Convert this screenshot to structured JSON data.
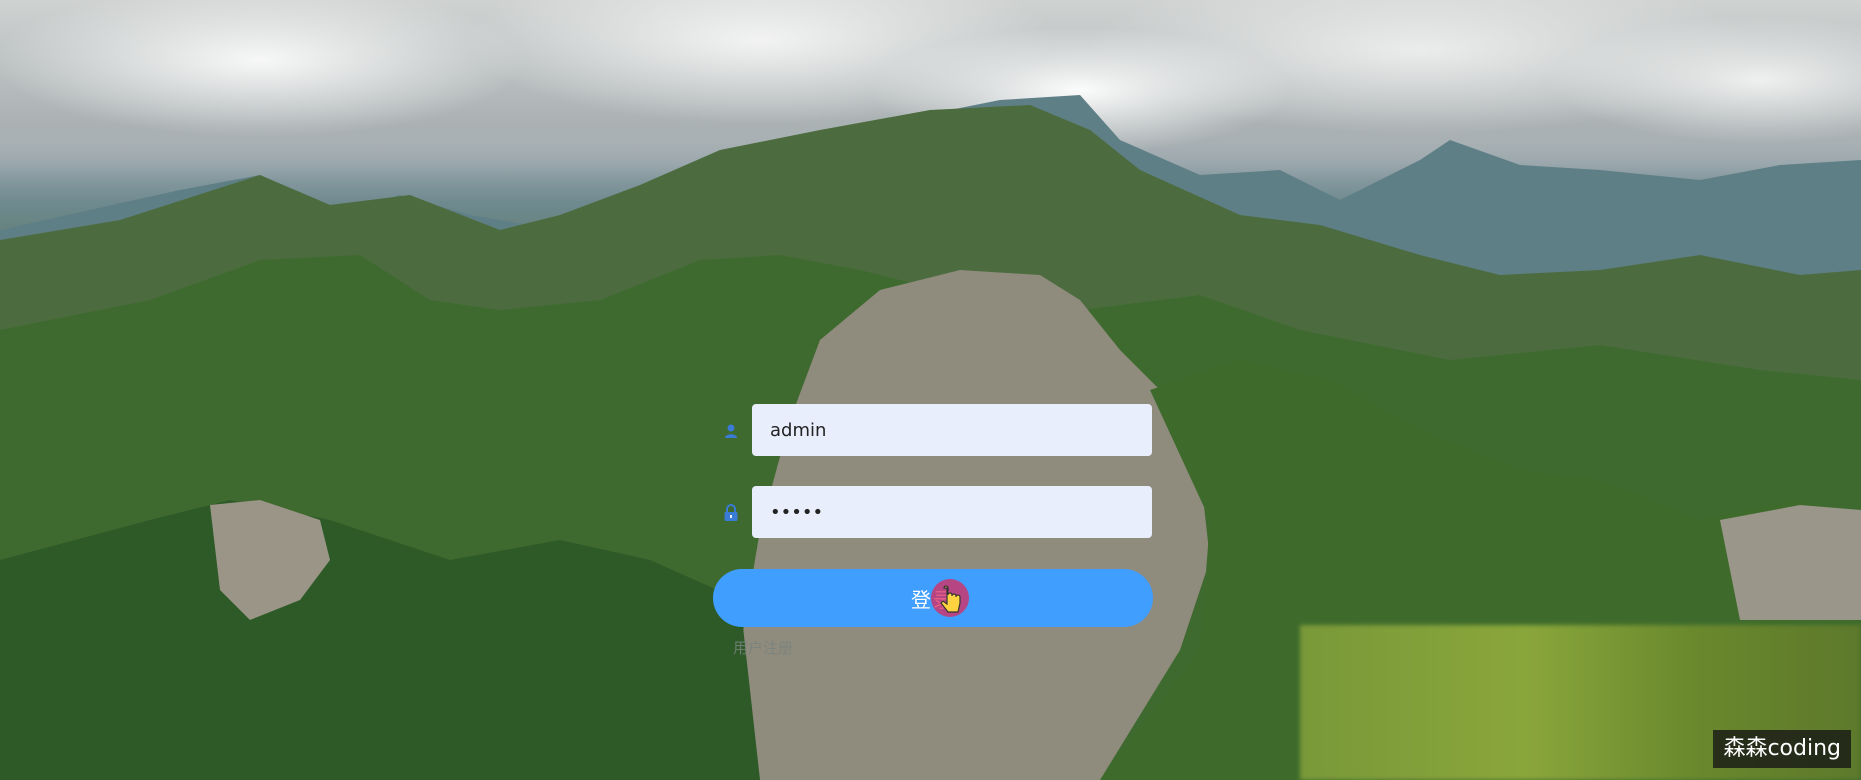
{
  "login": {
    "title": "",
    "username": {
      "value": "admin",
      "placeholder": ""
    },
    "password": {
      "value": "•••••",
      "placeholder": ""
    },
    "submit_label": "登录",
    "register_label": "用户注册",
    "accent_color": "#409eff",
    "input_background": "#e8eefc"
  },
  "watermark": {
    "text": "森森coding"
  },
  "icons": {
    "username_icon": "user-icon",
    "password_icon": "lock-icon",
    "cursor": "hand-pointer-icon"
  }
}
